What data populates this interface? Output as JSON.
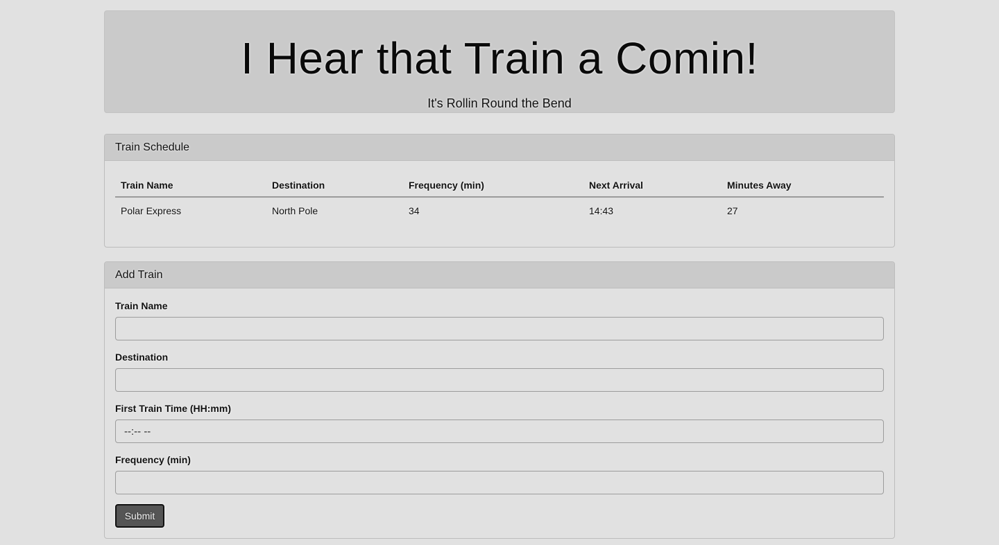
{
  "header": {
    "title": "I Hear that Train a Comin!",
    "subtitle": "It's Rollin Round the Bend"
  },
  "schedule": {
    "heading": "Train Schedule",
    "columns": [
      "Train Name",
      "Destination",
      "Frequency (min)",
      "Next Arrival",
      "Minutes Away"
    ],
    "rows": [
      [
        "Polar Express",
        "North Pole",
        "34",
        "14:43",
        "27"
      ]
    ]
  },
  "add_train": {
    "heading": "Add Train",
    "fields": [
      {
        "label": "Train Name",
        "value": "",
        "placeholder": ""
      },
      {
        "label": "Destination",
        "value": "",
        "placeholder": ""
      },
      {
        "label": "First Train Time (HH:mm)",
        "value": "",
        "placeholder": "--:-- --"
      },
      {
        "label": "Frequency (min)",
        "value": "",
        "placeholder": ""
      }
    ],
    "submit_label": "Submit"
  },
  "colors": {
    "background": "#e1e1e1",
    "panel_heading": "#cacaca",
    "button": "#555555"
  }
}
